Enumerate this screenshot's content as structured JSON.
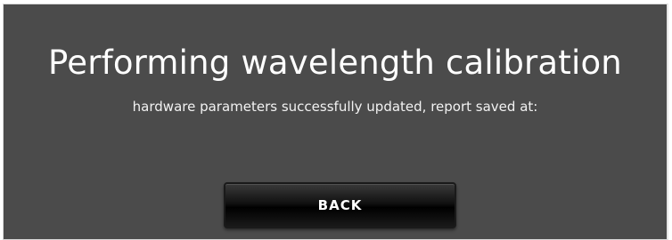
{
  "dialog": {
    "title": "Performing wavelength calibration",
    "message": "hardware parameters successfully updated, report saved at:",
    "back_label": "BACK"
  },
  "colors": {
    "panel_background": "#4b4b4b",
    "text": "#ffffff",
    "button_background": "#0d0d0d"
  }
}
